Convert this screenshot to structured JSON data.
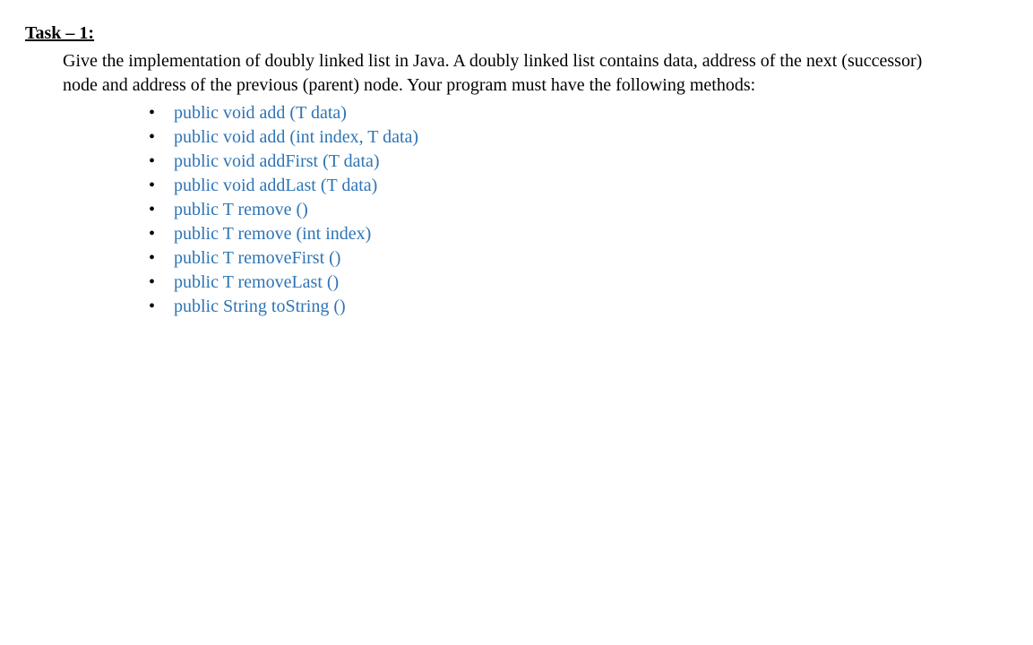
{
  "task": {
    "title": "Task – 1:",
    "description": "Give the implementation of doubly linked list in Java. A doubly linked list contains data, address of the next (successor) node and address of the previous (parent) node. Your program must have the following methods:",
    "methods": [
      "public void add (T data)",
      "public void add (int index, T data)",
      "public void addFirst (T data)",
      "public void addLast (T data)",
      "public T remove ()",
      "public T remove (int index)",
      "public T removeFirst ()",
      "public T removeLast ()",
      "public String toString ()"
    ]
  }
}
